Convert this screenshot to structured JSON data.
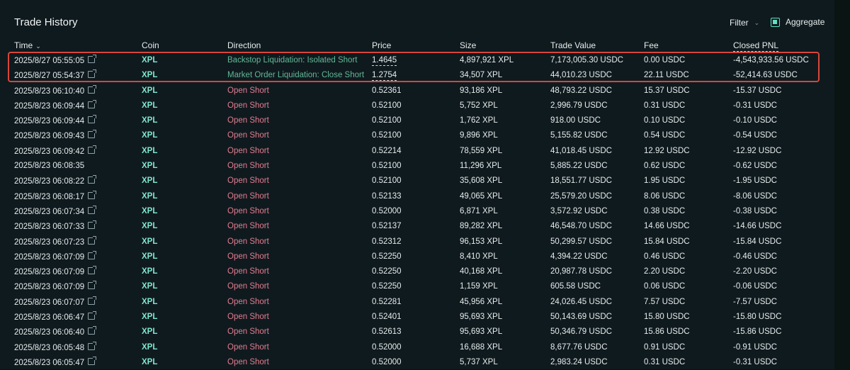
{
  "header": {
    "title": "Trade History",
    "filter_label": "Filter",
    "aggregate_label": "Aggregate"
  },
  "columns": {
    "time": "Time",
    "coin": "Coin",
    "direction": "Direction",
    "price": "Price",
    "size": "Size",
    "trade_value": "Trade Value",
    "fee": "Fee",
    "closed_pnl": "Closed PNL"
  },
  "rows": [
    {
      "time": "2025/8/27 05:55:05",
      "coin": "XPL",
      "direction": "Backstop Liquidation: Isolated Short",
      "kind": "liq",
      "price": "1.4645",
      "size": "4,897,921 XPL",
      "value": "7,173,005.30 USDC",
      "fee": "0.00 USDC",
      "pnl": "-4,543,933.56 USDC",
      "link": true
    },
    {
      "time": "2025/8/27 05:54:37",
      "coin": "XPL",
      "direction": "Market Order Liquidation: Close Short",
      "kind": "liq",
      "price": "1.2754",
      "size": "34,507 XPL",
      "value": "44,010.23 USDC",
      "fee": "22.11 USDC",
      "pnl": "-52,414.63 USDC",
      "link": true
    },
    {
      "time": "2025/8/23 06:10:40",
      "coin": "XPL",
      "direction": "Open Short",
      "kind": "short",
      "price": "0.52361",
      "size": "93,186 XPL",
      "value": "48,793.22 USDC",
      "fee": "15.37 USDC",
      "pnl": "-15.37 USDC",
      "link": true
    },
    {
      "time": "2025/8/23 06:09:44",
      "coin": "XPL",
      "direction": "Open Short",
      "kind": "short",
      "price": "0.52100",
      "size": "5,752 XPL",
      "value": "2,996.79 USDC",
      "fee": "0.31 USDC",
      "pnl": "-0.31 USDC",
      "link": true
    },
    {
      "time": "2025/8/23 06:09:44",
      "coin": "XPL",
      "direction": "Open Short",
      "kind": "short",
      "price": "0.52100",
      "size": "1,762 XPL",
      "value": "918.00 USDC",
      "fee": "0.10 USDC",
      "pnl": "-0.10 USDC",
      "link": true
    },
    {
      "time": "2025/8/23 06:09:43",
      "coin": "XPL",
      "direction": "Open Short",
      "kind": "short",
      "price": "0.52100",
      "size": "9,896 XPL",
      "value": "5,155.82 USDC",
      "fee": "0.54 USDC",
      "pnl": "-0.54 USDC",
      "link": true
    },
    {
      "time": "2025/8/23 06:09:42",
      "coin": "XPL",
      "direction": "Open Short",
      "kind": "short",
      "price": "0.52214",
      "size": "78,559 XPL",
      "value": "41,018.45 USDC",
      "fee": "12.92 USDC",
      "pnl": "-12.92 USDC",
      "link": true
    },
    {
      "time": "2025/8/23 06:08:35",
      "coin": "XPL",
      "direction": "Open Short",
      "kind": "short",
      "price": "0.52100",
      "size": "11,296 XPL",
      "value": "5,885.22 USDC",
      "fee": "0.62 USDC",
      "pnl": "-0.62 USDC",
      "link": false
    },
    {
      "time": "2025/8/23 06:08:22",
      "coin": "XPL",
      "direction": "Open Short",
      "kind": "short",
      "price": "0.52100",
      "size": "35,608 XPL",
      "value": "18,551.77 USDC",
      "fee": "1.95 USDC",
      "pnl": "-1.95 USDC",
      "link": true
    },
    {
      "time": "2025/8/23 06:08:17",
      "coin": "XPL",
      "direction": "Open Short",
      "kind": "short",
      "price": "0.52133",
      "size": "49,065 XPL",
      "value": "25,579.20 USDC",
      "fee": "8.06 USDC",
      "pnl": "-8.06 USDC",
      "link": true
    },
    {
      "time": "2025/8/23 06:07:34",
      "coin": "XPL",
      "direction": "Open Short",
      "kind": "short",
      "price": "0.52000",
      "size": "6,871 XPL",
      "value": "3,572.92 USDC",
      "fee": "0.38 USDC",
      "pnl": "-0.38 USDC",
      "link": true
    },
    {
      "time": "2025/8/23 06:07:33",
      "coin": "XPL",
      "direction": "Open Short",
      "kind": "short",
      "price": "0.52137",
      "size": "89,282 XPL",
      "value": "46,548.70 USDC",
      "fee": "14.66 USDC",
      "pnl": "-14.66 USDC",
      "link": true
    },
    {
      "time": "2025/8/23 06:07:23",
      "coin": "XPL",
      "direction": "Open Short",
      "kind": "short",
      "price": "0.52312",
      "size": "96,153 XPL",
      "value": "50,299.57 USDC",
      "fee": "15.84 USDC",
      "pnl": "-15.84 USDC",
      "link": true
    },
    {
      "time": "2025/8/23 06:07:09",
      "coin": "XPL",
      "direction": "Open Short",
      "kind": "short",
      "price": "0.52250",
      "size": "8,410 XPL",
      "value": "4,394.22 USDC",
      "fee": "0.46 USDC",
      "pnl": "-0.46 USDC",
      "link": true
    },
    {
      "time": "2025/8/23 06:07:09",
      "coin": "XPL",
      "direction": "Open Short",
      "kind": "short",
      "price": "0.52250",
      "size": "40,168 XPL",
      "value": "20,987.78 USDC",
      "fee": "2.20 USDC",
      "pnl": "-2.20 USDC",
      "link": true
    },
    {
      "time": "2025/8/23 06:07:09",
      "coin": "XPL",
      "direction": "Open Short",
      "kind": "short",
      "price": "0.52250",
      "size": "1,159 XPL",
      "value": "605.58 USDC",
      "fee": "0.06 USDC",
      "pnl": "-0.06 USDC",
      "link": true
    },
    {
      "time": "2025/8/23 06:07:07",
      "coin": "XPL",
      "direction": "Open Short",
      "kind": "short",
      "price": "0.52281",
      "size": "45,956 XPL",
      "value": "24,026.45 USDC",
      "fee": "7.57 USDC",
      "pnl": "-7.57 USDC",
      "link": true
    },
    {
      "time": "2025/8/23 06:06:47",
      "coin": "XPL",
      "direction": "Open Short",
      "kind": "short",
      "price": "0.52401",
      "size": "95,693 XPL",
      "value": "50,143.69 USDC",
      "fee": "15.80 USDC",
      "pnl": "-15.80 USDC",
      "link": true
    },
    {
      "time": "2025/8/23 06:06:40",
      "coin": "XPL",
      "direction": "Open Short",
      "kind": "short",
      "price": "0.52613",
      "size": "95,693 XPL",
      "value": "50,346.79 USDC",
      "fee": "15.86 USDC",
      "pnl": "-15.86 USDC",
      "link": true
    },
    {
      "time": "2025/8/23 06:05:48",
      "coin": "XPL",
      "direction": "Open Short",
      "kind": "short",
      "price": "0.52000",
      "size": "16,688 XPL",
      "value": "8,677.76 USDC",
      "fee": "0.91 USDC",
      "pnl": "-0.91 USDC",
      "link": true
    },
    {
      "time": "2025/8/23 06:05:47",
      "coin": "XPL",
      "direction": "Open Short",
      "kind": "short",
      "price": "0.52000",
      "size": "5,737 XPL",
      "value": "2,983.24 USDC",
      "fee": "0.31 USDC",
      "pnl": "-0.31 USDC",
      "link": true
    }
  ],
  "colors": {
    "coin": "#7de8cf",
    "short": "#e27d8d",
    "liquidation": "#62b894",
    "highlight_box": "#d8463a"
  }
}
